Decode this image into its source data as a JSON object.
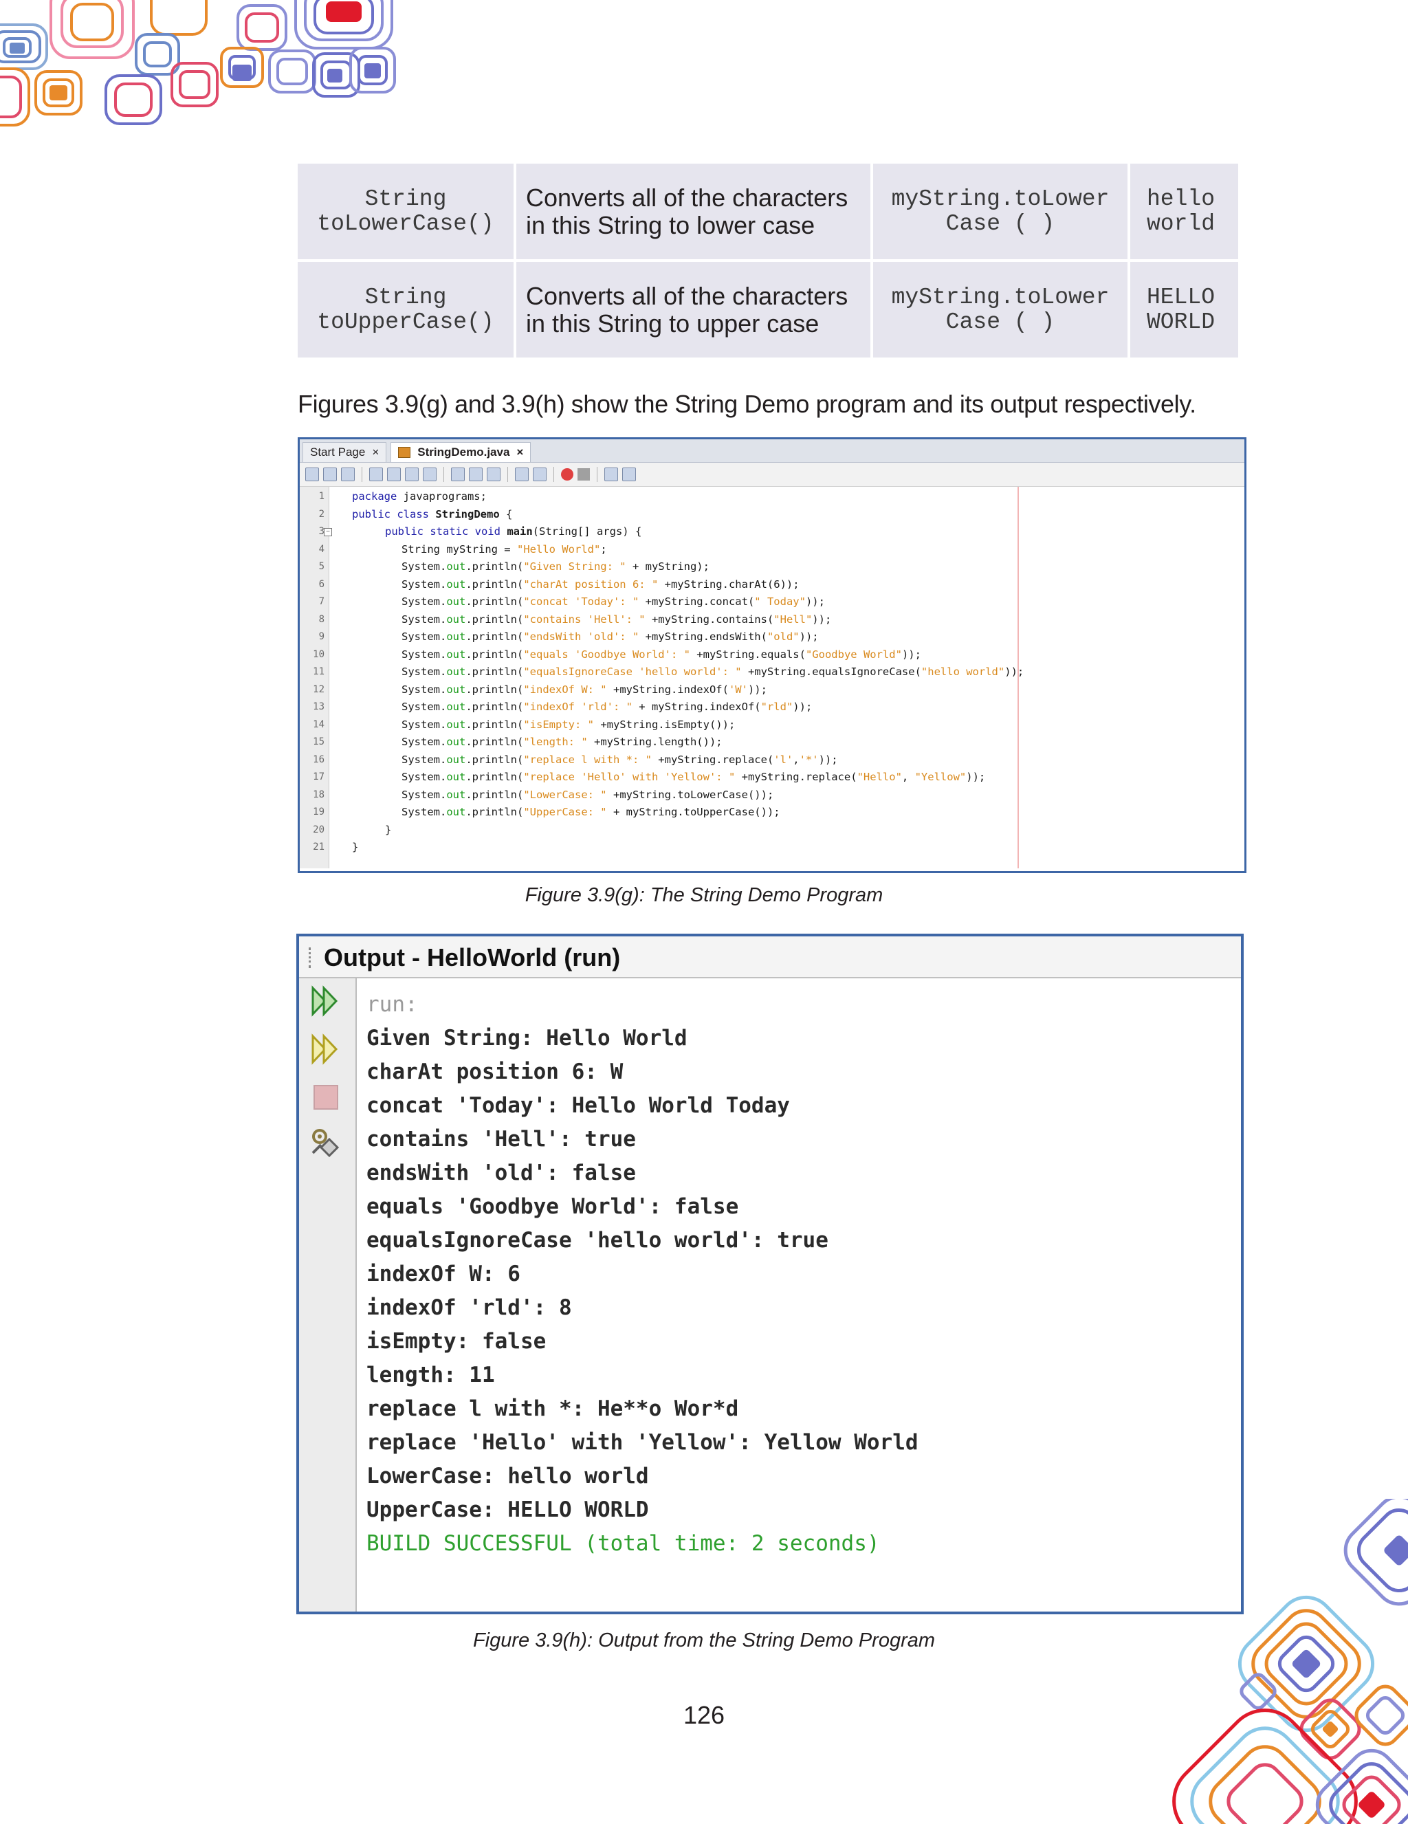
{
  "table": {
    "rows": [
      {
        "signature_line1": "String",
        "signature_line2": "toLowerCase()",
        "description_line1": "Converts all of the characters",
        "description_line2": "in this String to lower case",
        "example_line1": "myString.toLower",
        "example_line2": "Case ( )",
        "result_line1": "hello",
        "result_line2": "world"
      },
      {
        "signature_line1": "String",
        "signature_line2": "toUpperCase()",
        "description_line1": "Converts all of the characters",
        "description_line2": "in this String to upper case",
        "example_line1": "myString.toLower",
        "example_line2": "Case ( )",
        "result_line1": "HELLO",
        "result_line2": "WORLD"
      }
    ]
  },
  "intro_text": "Figures 3.9(g) and 3.9(h) show the String Demo program and its output respectively.",
  "editor": {
    "tabs": [
      "Start Page",
      "StringDemo.java"
    ],
    "tab_close": "×",
    "line_numbers": [
      "1",
      "2",
      "3",
      "4",
      "5",
      "6",
      "7",
      "8",
      "9",
      "10",
      "11",
      "12",
      "13",
      "14",
      "15",
      "16",
      "17",
      "18",
      "19",
      "20",
      "21"
    ]
  },
  "caption_g": "Figure 3.9(g): The String Demo Program",
  "output": {
    "title": "Output - HelloWorld (run)",
    "run_label": "run:",
    "lines": [
      "Given String: Hello World",
      "charAt position 6: W",
      "concat 'Today': Hello World Today",
      "contains 'Hell': true",
      "endsWith 'old': false",
      "equals 'Goodbye World': false",
      "equalsIgnoreCase 'hello world': true",
      "indexOf W: 6",
      "indexOf 'rld': 8",
      "isEmpty: false",
      "length: 11",
      "replace l with *: He**o Wor*d",
      "replace 'Hello' with 'Yellow': Yellow World",
      "LowerCase: hello world",
      "UpperCase: HELLO WORLD"
    ],
    "build_status": "BUILD SUCCESSFUL (total time: 2 seconds)"
  },
  "caption_h": "Figure 3.9(h): Output from the String Demo Program",
  "page_number": "126",
  "colors": {
    "frame_blue": "#3d66a6",
    "table_cell": "#e6e5ee",
    "keyword_blue": "#1e1ea8",
    "string_orange": "#d98a1e",
    "field_green": "#1a9a1a",
    "build_green": "#2ea02e"
  }
}
